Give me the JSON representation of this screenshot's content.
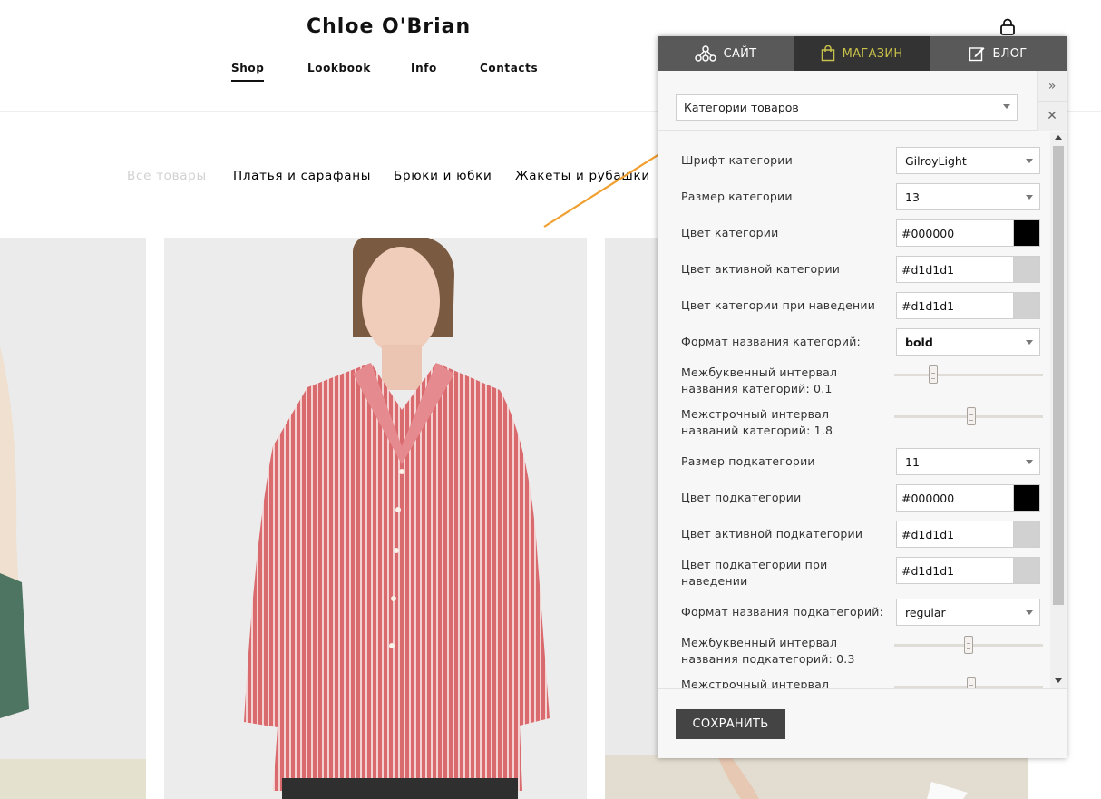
{
  "store": {
    "logo": "Chloe O'Brian",
    "nav": [
      {
        "label": "Shop",
        "active": true
      },
      {
        "label": "Lookbook",
        "active": false
      },
      {
        "label": "Info",
        "active": false
      },
      {
        "label": "Contacts",
        "active": false
      }
    ],
    "cart_icon": "lock-bag-icon",
    "categories": [
      {
        "label": "Все товары",
        "active": true
      },
      {
        "label": "Платья и сарафаны",
        "active": false
      },
      {
        "label": "Брюки и юбки",
        "active": false
      },
      {
        "label": "Жакеты и рубашки",
        "active": false
      }
    ]
  },
  "panel": {
    "tabs": [
      {
        "label": "САЙТ",
        "icon": "sitemap-icon",
        "active": false
      },
      {
        "label": "МАГАЗИН",
        "icon": "shopping-bag-icon",
        "active": true
      },
      {
        "label": "БЛОГ",
        "icon": "edit-icon",
        "active": false
      }
    ],
    "section_select": "Категории товаров",
    "expand_symbol": "»",
    "close_symbol": "✕",
    "settings": {
      "cat_font": {
        "label": "Шрифт категории",
        "value": "GilroyLight"
      },
      "cat_size": {
        "label": "Размер категории",
        "value": "13"
      },
      "cat_color": {
        "label": "Цвет категории",
        "value": "#000000",
        "swatch": "#000000"
      },
      "cat_active_color": {
        "label": "Цвет активной категории",
        "value": "#d1d1d1",
        "swatch": "#d1d1d1"
      },
      "cat_hover_color": {
        "label": "Цвет категории при наведении",
        "value": "#d1d1d1",
        "swatch": "#d1d1d1"
      },
      "cat_format": {
        "label": "Формат названия категорий:",
        "value": "bold"
      },
      "cat_letter_spacing": {
        "label": "Межбуквенный интервал названия категорий: 0.1",
        "level": 0.26
      },
      "cat_line_height": {
        "label": "Межстрочный интервал названий категорий: 1.8",
        "level": 0.52
      },
      "sub_size": {
        "label": "Размер подкатегории",
        "value": "11"
      },
      "sub_color": {
        "label": "Цвет подкатегории",
        "value": "#000000",
        "swatch": "#000000"
      },
      "sub_active_color": {
        "label": "Цвет активной подкатегории",
        "value": "#d1d1d1",
        "swatch": "#d1d1d1"
      },
      "sub_hover_color": {
        "label": "Цвет подкатегории при наведении",
        "value": "#d1d1d1",
        "swatch": "#d1d1d1"
      },
      "sub_format": {
        "label": "Формат названия подкатегорий:",
        "value": "regular"
      },
      "sub_letter_spacing": {
        "label": "Межбуквенный интервал названия подкатегорий: 0.3",
        "level": 0.5
      },
      "sub_line_height": {
        "label": "Межстрочный интервал",
        "level": 0.52
      }
    },
    "save_label": "СОХРАНИТЬ"
  },
  "colors": {
    "tab_bar": "#595959",
    "tab_active": "#333333",
    "tab_active_text": "#c9c14a",
    "save_button": "#444444",
    "annotation_arrow": "#f0a030"
  }
}
